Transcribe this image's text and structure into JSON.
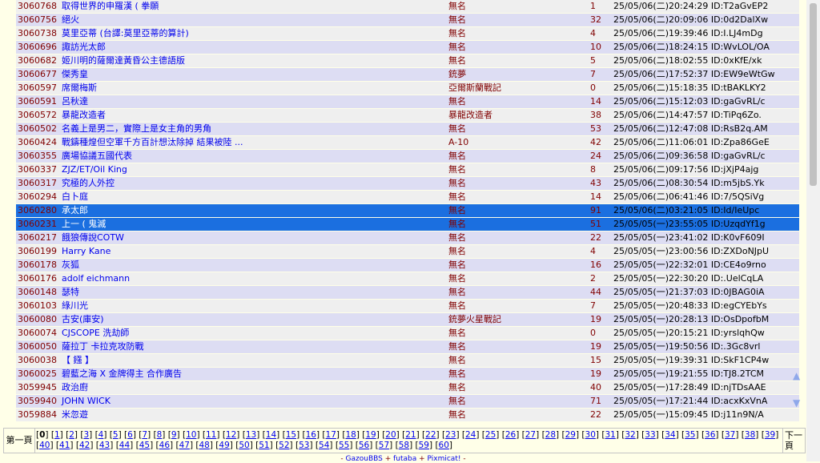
{
  "rows": [
    {
      "no": "3060768",
      "title": "取得世界的申羅漢 ( 拳願",
      "name": "無名",
      "count": "1",
      "date": "25/05/06(二)20:24:29 ID:T2aGvEP2"
    },
    {
      "no": "3060756",
      "title": "絕火",
      "name": "無名",
      "count": "32",
      "date": "25/05/06(二)20:09:06 ID:0d2DalXw"
    },
    {
      "no": "3060738",
      "title": "莫里亞蒂 (台譯:莫里亞蒂的算計)",
      "name": "無名",
      "count": "4",
      "date": "25/05/06(二)19:39:46 ID:I.LJ4mDg"
    },
    {
      "no": "3060696",
      "title": "諏訪光太郎",
      "name": "無名",
      "count": "10",
      "date": "25/05/06(二)18:24:15 ID:WvLOL/OA"
    },
    {
      "no": "3060682",
      "title": "姬川明的薩爾達黃昏公主德語版",
      "name": "無名",
      "count": "5",
      "date": "25/05/06(二)18:02:55 ID:0xKfE/xk"
    },
    {
      "no": "3060677",
      "title": "傑秀皇",
      "name": "銃夢",
      "count": "7",
      "date": "25/05/06(二)17:52:37 ID:EW9eWtGw"
    },
    {
      "no": "3060597",
      "title": "席爾梅斯",
      "name": "亞爾斯蘭戰記",
      "count": "0",
      "date": "25/05/06(二)15:18:35 ID:tBAKLKY2"
    },
    {
      "no": "3060591",
      "title": "呂秋達",
      "name": "無名",
      "count": "14",
      "date": "25/05/06(二)15:12:03 ID:gaGvRL/c"
    },
    {
      "no": "3060572",
      "title": "暴龍改造者",
      "name": "暴龍改造者",
      "count": "38",
      "date": "25/05/06(二)14:47:57 ID:TiPq6Zo."
    },
    {
      "no": "3060502",
      "title": "名義上是男二，實際上是女主角的男角",
      "name": "無名",
      "count": "53",
      "date": "25/05/06(二)12:47:08 ID:RsB2q.AM"
    },
    {
      "no": "3060424",
      "title": "戰鑄種煌但空軍千方百計想汰除掉 結果被陸 ...",
      "name": "A-10",
      "count": "42",
      "date": "25/05/06(二)11:06:01 ID:Zpa86GeE",
      "dark": true
    },
    {
      "no": "3060355",
      "title": "廣場協議五國代表",
      "name": "無名",
      "count": "24",
      "date": "25/05/06(二)09:36:58 ID:gaGvRL/c"
    },
    {
      "no": "3060337",
      "title": "ZJZ/ET/Oil King",
      "name": "無名",
      "count": "8",
      "date": "25/05/06(二)09:17:56 ID:jXjP4ajg",
      "dark": true
    },
    {
      "no": "3060317",
      "title": "究極的人外控",
      "name": "無名",
      "count": "43",
      "date": "25/05/06(二)08:30:54 ID:m5jbS.Yk"
    },
    {
      "no": "3060294",
      "title": "白卜庭",
      "name": "無名",
      "count": "14",
      "date": "25/05/06(二)06:41:46 ID:7/5QSiVg"
    },
    {
      "no": "3060280",
      "title": "承太郎",
      "name": "無名",
      "count": "91",
      "date": "25/05/06(二)03:21:05 ID:Id/IeUpc",
      "sel": true
    },
    {
      "no": "3060231",
      "title": "上一 ( 鬼滅",
      "name": "無名",
      "count": "51",
      "date": "25/05/05(一)23:55:05 ID:UzqdYf1g",
      "sel": true
    },
    {
      "no": "3060217",
      "title": "餓狼傳說COTW",
      "name": "無名",
      "count": "22",
      "date": "25/05/05(一)23:41:02 ID:K0vF609I"
    },
    {
      "no": "3060199",
      "title": "Harry Kane",
      "name": "無名",
      "count": "4",
      "date": "25/05/05(一)23:00:56 ID:ZXDoNJpU"
    },
    {
      "no": "3060178",
      "title": "灰狐",
      "name": "無名",
      "count": "16",
      "date": "25/05/05(一)22:32:01 ID:CE4o9rno"
    },
    {
      "no": "3060176",
      "title": "adolf eichmann",
      "name": "無名",
      "count": "2",
      "date": "25/05/05(一)22:30:20 ID:.UelCqLA",
      "dark": true
    },
    {
      "no": "3060148",
      "title": "瑟特",
      "name": "無名",
      "count": "44",
      "date": "25/05/05(一)21:37:03 ID:0JBAG0iA"
    },
    {
      "no": "3060103",
      "title": "綠川光",
      "name": "無名",
      "count": "7",
      "date": "25/05/05(一)20:48:33 ID:egCYEbYs"
    },
    {
      "no": "3060080",
      "title": "古安(庫安)",
      "name": "銃夢火星戰記",
      "count": "19",
      "date": "25/05/05(一)20:28:13 ID:OsDpofbM"
    },
    {
      "no": "3060074",
      "title": "CJSCOPE 洗劫師",
      "name": "無名",
      "count": "0",
      "date": "25/05/05(一)20:15:21 ID:yrslqhQw",
      "dark": true
    },
    {
      "no": "3060050",
      "title": "薩拉丁 卡拉克攻防戰",
      "name": "無名",
      "count": "19",
      "date": "25/05/05(一)19:50:56 ID:.3Gc8vrl",
      "dark": true
    },
    {
      "no": "3060038",
      "title": "【 鏹 】",
      "name": "無名",
      "count": "15",
      "date": "25/05/05(一)19:39:31 ID:SkF1CP4w",
      "dark": true
    },
    {
      "no": "3060025",
      "title": "碧藍之海 X 金牌得主 合作廣告",
      "name": "無名",
      "count": "19",
      "date": "25/05/05(一)19:21:55 ID:TJ8.2TCM"
    },
    {
      "no": "3059945",
      "title": "政治廚",
      "name": "無名",
      "count": "40",
      "date": "25/05/05(一)17:28:49 ID:njTDsAAE"
    },
    {
      "no": "3059940",
      "title": "JOHN WICK",
      "name": "無名",
      "count": "71",
      "date": "25/05/05(一)17:21:44 ID:acxKxVnA",
      "dark": true
    },
    {
      "no": "3059884",
      "title": "米忽遊",
      "name": "無名",
      "count": "22",
      "date": "25/05/05(一)15:09:45 ID:j11n9N/A"
    }
  ],
  "pager": {
    "prev_label": "第一頁",
    "next_label": "下一頁",
    "current": "0",
    "pages": [
      "1",
      "2",
      "3",
      "4",
      "5",
      "6",
      "7",
      "8",
      "9",
      "10",
      "11",
      "12",
      "13",
      "14",
      "15",
      "16",
      "17",
      "18",
      "19",
      "20",
      "21",
      "22",
      "23",
      "24",
      "25",
      "26",
      "27",
      "28",
      "29",
      "30",
      "31",
      "32",
      "33",
      "34",
      "35",
      "36",
      "37",
      "38",
      "39",
      "40",
      "41",
      "42",
      "43",
      "44",
      "45",
      "46",
      "47",
      "48",
      "49",
      "50",
      "51",
      "52",
      "53",
      "54",
      "55",
      "56",
      "57",
      "58",
      "59",
      "60"
    ]
  },
  "footer": {
    "prefix": "- ",
    "link1": "GazouBBS",
    "sep1": " + ",
    "link2": "futaba",
    "sep2": " + ",
    "link3": "Pixmicat!",
    "suffix": " -"
  },
  "icons": {
    "up": "▲",
    "down": "▼"
  },
  "colors": {
    "row_odd": "#efefef",
    "row_even": "#ddddf3",
    "selected": "#1b6fe0",
    "link": "#0000ee",
    "text": "#800000"
  }
}
